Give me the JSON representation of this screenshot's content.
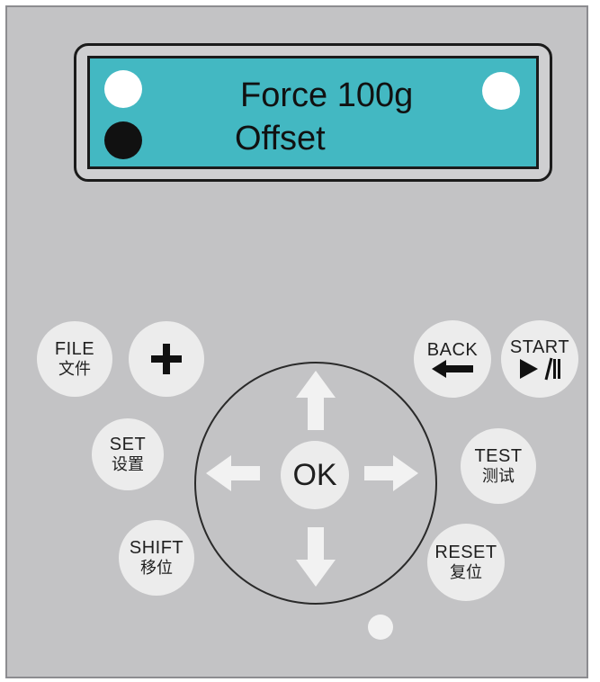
{
  "display": {
    "line1": "Force 100g",
    "line2": "Offset",
    "indicators": {
      "top_left": "white",
      "bottom_left": "black",
      "top_right": "white"
    }
  },
  "buttons": {
    "file": {
      "label": "FILE",
      "sub": "文件"
    },
    "plus": {
      "label": "+"
    },
    "set": {
      "label": "SET",
      "sub": "设置"
    },
    "shift": {
      "label": "SHIFT",
      "sub": "移位"
    },
    "back": {
      "label": "BACK",
      "sub": "←"
    },
    "start": {
      "label": "START",
      "sub": "►/ll"
    },
    "test": {
      "label": "TEST",
      "sub": "测试"
    },
    "reset": {
      "label": "RESET",
      "sub": "复位"
    },
    "ok": {
      "label": "OK"
    }
  },
  "colors": {
    "panel": "#c3c3c5",
    "lcd": "#43b8c2",
    "button": "#ececec",
    "indicator_white": "#ffffff",
    "indicator_black": "#111111"
  }
}
